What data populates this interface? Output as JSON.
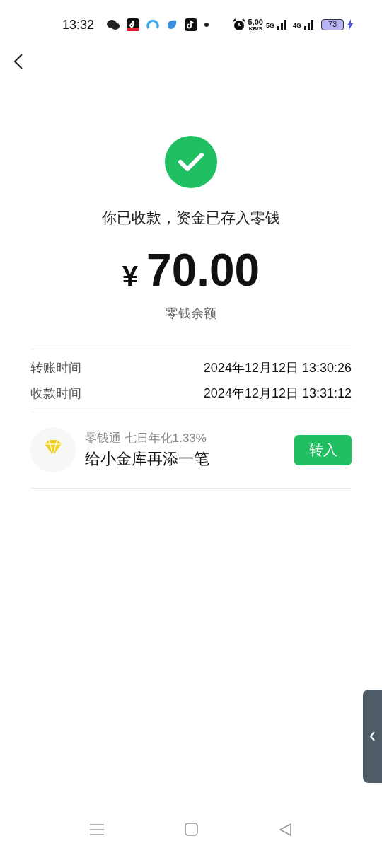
{
  "status_bar": {
    "time": "13:32",
    "speed": "5.00",
    "speed_unit": "KB/S",
    "net_1": "5G",
    "net_2": "4G",
    "battery": "73"
  },
  "result": {
    "message": "你已收款，资金已存入零钱",
    "currency": "¥",
    "amount": "70.00",
    "destination": "零钱余额"
  },
  "details": [
    {
      "label": "转账时间",
      "value": "2024年12月12日 13:30:26"
    },
    {
      "label": "收款时间",
      "value": "2024年12月12日 13:31:12"
    }
  ],
  "promo": {
    "subtitle": "零钱通 七日年化1.33%",
    "title": "给小金库再添一笔",
    "button": "转入"
  }
}
